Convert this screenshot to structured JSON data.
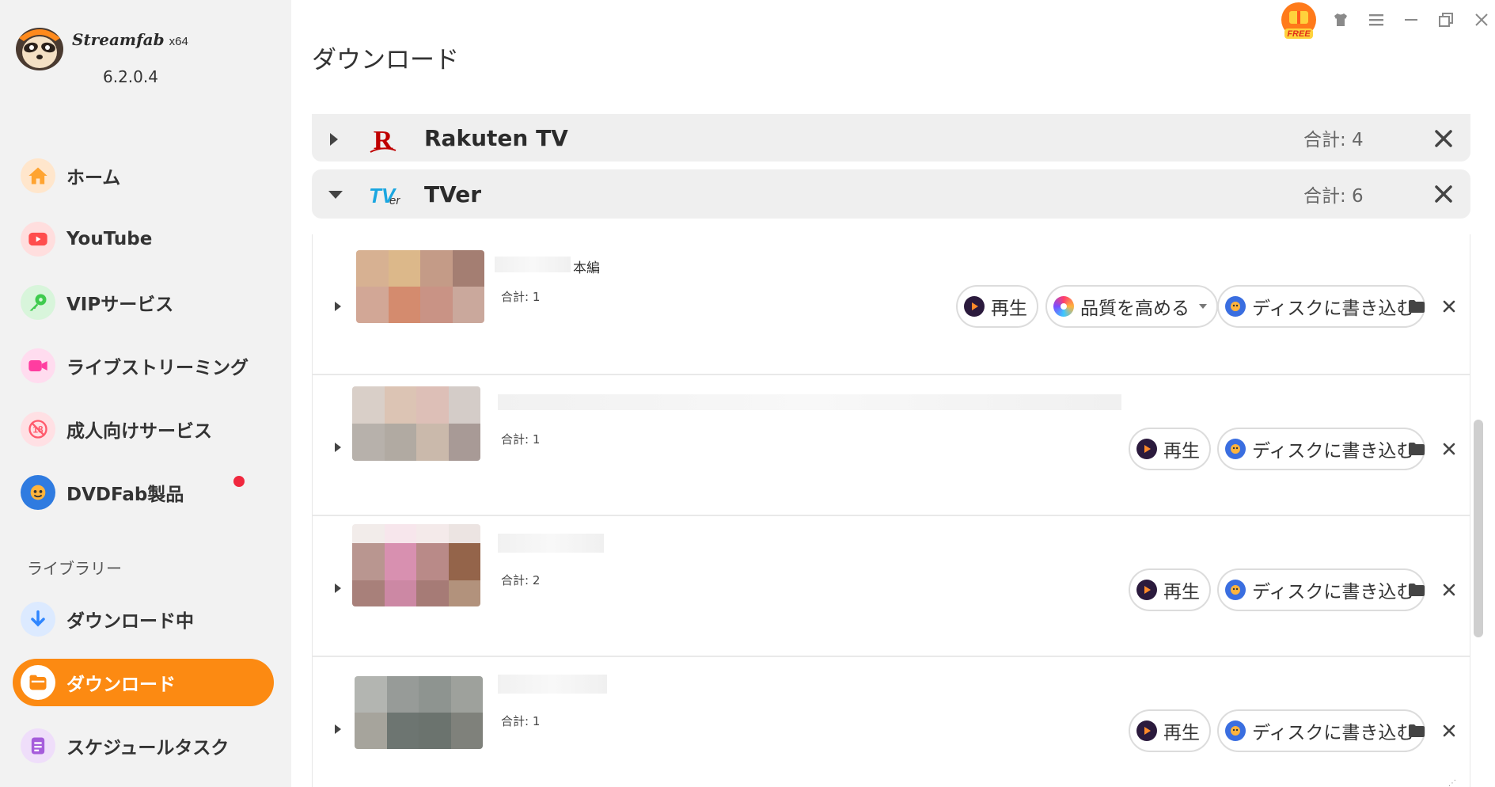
{
  "app": {
    "brand": "Streamfab",
    "arch": "x64",
    "version": "6.2.0.4"
  },
  "sidebar": {
    "items": [
      {
        "label": "ホーム",
        "icon": "home-icon",
        "color": "#ffa431"
      },
      {
        "label": "YouTube",
        "icon": "youtube-icon",
        "color": "#ff4d4d"
      },
      {
        "label": "VIPサービス",
        "icon": "key-icon",
        "color": "#3fcb4e"
      },
      {
        "label": "ライブストリーミング",
        "icon": "camera-icon",
        "color": "#ff3da0"
      },
      {
        "label": "成人向けサービス",
        "icon": "adult-18-icon",
        "color": "#ff5a6c"
      },
      {
        "label": "DVDFab製品",
        "icon": "dvdfab-icon",
        "color": "#2f7be0"
      }
    ],
    "library_title": "ライブラリー",
    "library": [
      {
        "label": "ダウンロード中",
        "icon": "download-arrow-icon",
        "color": "#2f86ff"
      },
      {
        "label": "ダウンロード",
        "icon": "folder-icon",
        "color": "#fc8a12",
        "active": true
      },
      {
        "label": "スケジュールタスク",
        "icon": "schedule-list-icon",
        "color": "#a55cdb"
      }
    ]
  },
  "topbar": {
    "free_badge": "FREE"
  },
  "page": {
    "title": "ダウンロード"
  },
  "groups": [
    {
      "name": "Rakuten TV",
      "total": "合計: 4",
      "expanded": false,
      "logo_color": "#bf0000"
    },
    {
      "name": "TVer",
      "total": "合計: 6",
      "expanded": true,
      "logo_color": "#1aa6e0"
    }
  ],
  "items": [
    {
      "title_suffix": "本編",
      "total": "合計: 1",
      "buttons": {
        "play": "再生",
        "enhance": "品質を高める",
        "burn": "ディスクに書き込む"
      }
    },
    {
      "title_suffix": "",
      "total": "合計: 1",
      "buttons": {
        "play": "再生",
        "burn": "ディスクに書き込む"
      }
    },
    {
      "title_suffix": "",
      "total": "合計: 2",
      "buttons": {
        "play": "再生",
        "burn": "ディスクに書き込む"
      }
    },
    {
      "title_suffix": "",
      "total": "合計: 1",
      "buttons": {
        "play": "再生",
        "burn": "ディスクに書き込む"
      }
    }
  ],
  "colors": {
    "accent": "#fc8a12",
    "sidebar_bg": "#f2f2f2",
    "group_bg": "#efefef"
  }
}
